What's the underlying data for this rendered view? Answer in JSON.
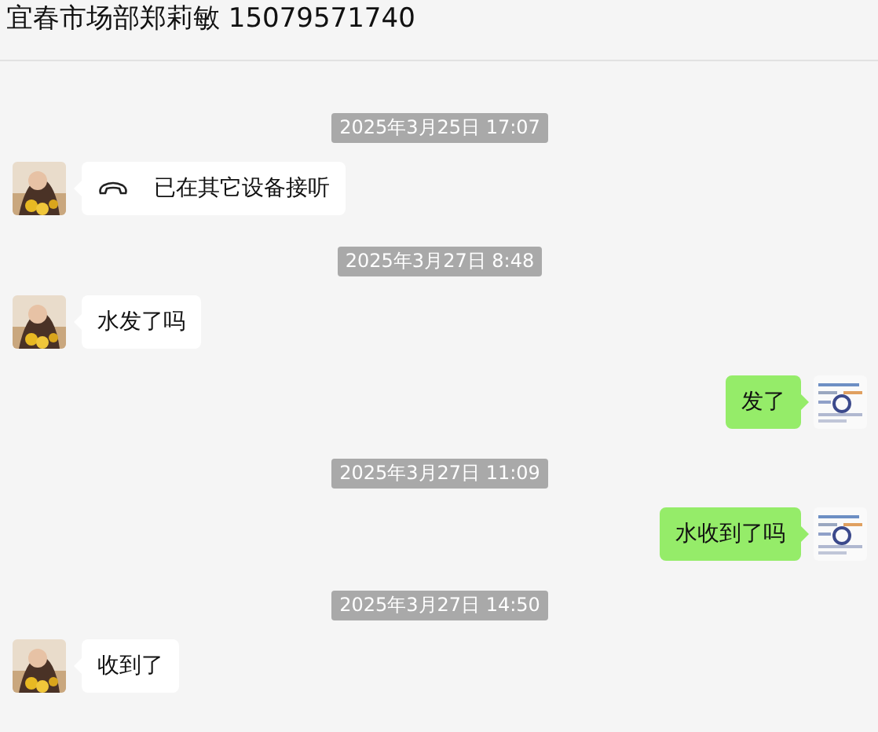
{
  "header": {
    "title": "宜春市场部郑莉敏 15079571740"
  },
  "messages": [
    {
      "kind": "time",
      "text": "2025年3月25日 17:07"
    },
    {
      "kind": "call",
      "outgoing": false,
      "text": "已在其它设备接听"
    },
    {
      "kind": "time",
      "text": "2025年3月27日 8:48"
    },
    {
      "kind": "text",
      "outgoing": false,
      "text": "水发了吗"
    },
    {
      "kind": "text",
      "outgoing": true,
      "text": "发了"
    },
    {
      "kind": "time",
      "text": "2025年3月27日 11:09"
    },
    {
      "kind": "text",
      "outgoing": true,
      "text": "水收到了吗"
    },
    {
      "kind": "time",
      "text": "2025年3月27日 14:50"
    },
    {
      "kind": "text",
      "outgoing": false,
      "text": "收到了"
    }
  ]
}
